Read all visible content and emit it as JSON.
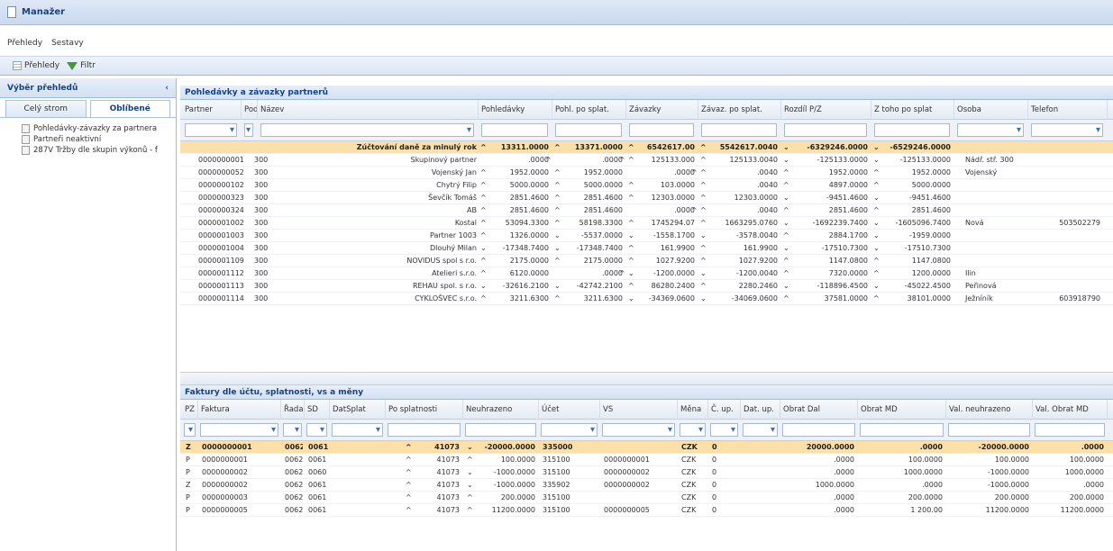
{
  "window": {
    "title": "Manažer"
  },
  "menu": [
    "Přehledy",
    "Sestavy"
  ],
  "toolbar": {
    "prehledy": "Přehledy",
    "filtr": "Filtr"
  },
  "left_panel": {
    "title": "Výběr přehledů",
    "collapse": "‹",
    "tabs": [
      "Celý strom",
      "Oblíbené"
    ],
    "tree": [
      "Pohledávky-závazky za partnera",
      "Partneři neaktivní",
      "287V Tržby dle skupin výkonů - f"
    ]
  },
  "top_panel": {
    "title": "Pohledávky a závazky partnerů",
    "columns": [
      "Partner",
      "Podř",
      "Název",
      "Pohledávky",
      "Pohl. po splat.",
      "Závazky",
      "Závaz. po splat.",
      "Rozdíl P/Z",
      "Z toho po splat",
      "Osoba",
      "Telefon"
    ],
    "summary": {
      "name": "Zúčtování daně za minulý rok",
      "pohl": "13311.0000",
      "pohl_ps": "13371.0000",
      "zav": "6542617.00",
      "zav_ps": "5542617.0040",
      "rozdil": "-6329246.0000",
      "ztoho": "-6529246.0000"
    },
    "rows": [
      {
        "partner": "0000000001",
        "podr": "300",
        "nazev": "Skupinový partner",
        "pohl": ".0000",
        "pohl_ps": ".0000",
        "zav": "125133.000",
        "zav_ps": "125133.0040",
        "rozdil": "-125133.0000",
        "ztoho": "-125133.0000",
        "osoba": "Nádř. stř. 300",
        "telefon": ""
      },
      {
        "partner": "0000000052",
        "podr": "300",
        "nazev": "Vojenský Jan",
        "pohl": "1952.0000",
        "pohl_ps": "1952.0000",
        "zav": ".0000",
        "zav_ps": ".0040",
        "rozdil": "1952.0000",
        "ztoho": "1952.0000",
        "osoba": "Vojenský",
        "telefon": ""
      },
      {
        "partner": "0000000102",
        "podr": "300",
        "nazev": "Chytrý Filip",
        "pohl": "5000.0000",
        "pohl_ps": "5000.0000",
        "zav": "103.0000",
        "zav_ps": ".0040",
        "rozdil": "4897.0000",
        "ztoho": "5000.0000",
        "osoba": "",
        "telefon": ""
      },
      {
        "partner": "0000000323",
        "podr": "300",
        "nazev": "Ševčík Tomáš",
        "pohl": "2851.4600",
        "pohl_ps": "2851.4600",
        "zav": "12303.0000",
        "zav_ps": "12303.0000",
        "rozdil": "-9451.4600",
        "ztoho": "-9451.4600",
        "osoba": "",
        "telefon": ""
      },
      {
        "partner": "0000000324",
        "podr": "300",
        "nazev": "AB",
        "pohl": "2851.4600",
        "pohl_ps": "2851.4600",
        "zav": ".0000",
        "zav_ps": ".0040",
        "rozdil": "2851.4600",
        "ztoho": "2851.4600",
        "osoba": "",
        "telefon": ""
      },
      {
        "partner": "0000001002",
        "podr": "300",
        "nazev": "Kostal",
        "pohl": "53094.3300",
        "pohl_ps": "58198.3300",
        "zav": "1745294.07",
        "zav_ps": "1663295.0760",
        "rozdil": "-1692239.7400",
        "ztoho": "-1605096.7400",
        "osoba": "Nová",
        "telefon": "503502279"
      },
      {
        "partner": "0000001003",
        "podr": "300",
        "nazev": "Partner 1003",
        "pohl": "1326.0000",
        "pohl_ps": "-5537.0000",
        "zav": "-1558.1700",
        "zav_ps": "-3578.0040",
        "rozdil": "2884.1700",
        "ztoho": "-1959.0000",
        "osoba": "",
        "telefon": ""
      },
      {
        "partner": "0000001004",
        "podr": "300",
        "nazev": "Dlouhý Milan",
        "pohl": "-17348.7400",
        "pohl_ps": "-17348.7400",
        "zav": "161.9900",
        "zav_ps": "161.9900",
        "rozdil": "-17510.7300",
        "ztoho": "-17510.7300",
        "osoba": "",
        "telefon": ""
      },
      {
        "partner": "0000001109",
        "podr": "300",
        "nazev": "NOVIDUS spol s r.o.",
        "pohl": "2175.0000",
        "pohl_ps": "2175.0000",
        "zav": "1027.9200",
        "zav_ps": "1027.9200",
        "rozdil": "1147.0800",
        "ztoho": "1147.0800",
        "osoba": "",
        "telefon": ""
      },
      {
        "partner": "0000001112",
        "podr": "300",
        "nazev": "Atelieri s.r.o.",
        "pohl": "6120.0000",
        "pohl_ps": ".0000",
        "zav": "-1200.0000",
        "zav_ps": "-1200.0040",
        "rozdil": "7320.0000",
        "ztoho": "1200.0000",
        "osoba": "Ilin",
        "telefon": ""
      },
      {
        "partner": "0000001113",
        "podr": "300",
        "nazev": "REHAU spol. s r.o.",
        "pohl": "-32616.2100",
        "pohl_ps": "-42742.2100",
        "zav": "86280.2400",
        "zav_ps": "2280.2460",
        "rozdil": "-118896.4500",
        "ztoho": "-45022.4500",
        "osoba": "Peřinová",
        "telefon": ""
      },
      {
        "partner": "0000001114",
        "podr": "300",
        "nazev": "CYKLOŠVEC s.r.o.",
        "pohl": "3211.6300",
        "pohl_ps": "3211.6300",
        "zav": "-34369.0600",
        "zav_ps": "-34069.0600",
        "rozdil": "37581.0000",
        "ztoho": "38101.0000",
        "osoba": "Ježníník",
        "telefon": "603918790"
      }
    ]
  },
  "bottom_panel": {
    "title": "Faktury dle účtu, splatnosti, vs a měny",
    "columns": [
      "PZ",
      "Faktura",
      "Řada",
      "SD",
      "DatSplat",
      "Po splatnosti",
      "Neuhrazeno",
      "Účet",
      "VS",
      "Měna",
      "Č. up.",
      "Dat. up.",
      "Obrat Dal",
      "Obrat MD",
      "Val. neuhrazeno",
      "Val. Obrat MD"
    ],
    "rows": [
      {
        "pz": "Z",
        "faktura": "0000000001",
        "rada": "0062",
        "sd": "0061",
        "posplat": "41073",
        "neuhr": "-20000.0000",
        "ucet": "335000",
        "vs": "",
        "mena": "CZK",
        "cup": "0",
        "dal": "20000.0000",
        "md": ".0000",
        "valneuhr": "-20000.0000",
        "valmd": ".0000",
        "sum": true
      },
      {
        "pz": "P",
        "faktura": "0000000001",
        "rada": "0062",
        "sd": "0061",
        "posplat": "41073",
        "neuhr": "100.0000",
        "ucet": "315100",
        "vs": "0000000001",
        "mena": "CZK",
        "cup": "0",
        "dal": ".0000",
        "md": "100.0000",
        "valneuhr": "100.0000",
        "valmd": "100.0000"
      },
      {
        "pz": "P",
        "faktura": "0000000002",
        "rada": "0062",
        "sd": "0060",
        "posplat": "41073",
        "neuhr": "-1000.0000",
        "ucet": "315100",
        "vs": "0000000002",
        "mena": "CZK",
        "cup": "0",
        "dal": ".0000",
        "md": "1000.0000",
        "valneuhr": "-1000.0000",
        "valmd": "1000.0000"
      },
      {
        "pz": "Z",
        "faktura": "0000000002",
        "rada": "0062",
        "sd": "0061",
        "posplat": "41073",
        "neuhr": "-1000.0000",
        "ucet": "335902",
        "vs": "0000000002",
        "mena": "CZK",
        "cup": "0",
        "dal": "1000.0000",
        "md": ".0000",
        "valneuhr": "-1000.0000",
        "valmd": ".0000"
      },
      {
        "pz": "P",
        "faktura": "0000000003",
        "rada": "0062",
        "sd": "0061",
        "posplat": "41073",
        "neuhr": "200.0000",
        "ucet": "315100",
        "vs": "",
        "mena": "CZK",
        "cup": "0",
        "dal": ".0000",
        "md": "200.0000",
        "valneuhr": "200.0000",
        "valmd": "200.0000"
      },
      {
        "pz": "P",
        "faktura": "0000000005",
        "rada": "0062",
        "sd": "0061",
        "posplat": "41073",
        "neuhr": "11200.0000",
        "ucet": "315100",
        "vs": "0000000005",
        "mena": "CZK",
        "cup": "0",
        "dal": ".0000",
        "md": "1 200.00",
        "valneuhr": "11200.0000",
        "valmd": "11200.0000"
      }
    ]
  },
  "colors": {
    "positive": "#2b8a2b",
    "negative": "#d12020",
    "summary_row": "#fde0a8",
    "header_blue": "#15428b"
  },
  "icons": {
    "filter": "funnel-icon",
    "list": "list-icon",
    "trend_up": "arrow-up-icon",
    "trend_down": "arrow-down-icon"
  }
}
